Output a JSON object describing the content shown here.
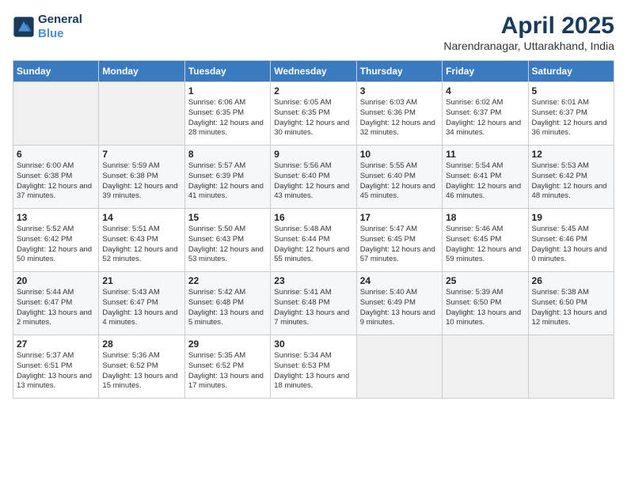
{
  "header": {
    "logo_line1": "General",
    "logo_line2": "Blue",
    "title": "April 2025",
    "subtitle": "Narendranagar, Uttarakhand, India"
  },
  "days_of_week": [
    "Sunday",
    "Monday",
    "Tuesday",
    "Wednesday",
    "Thursday",
    "Friday",
    "Saturday"
  ],
  "weeks": [
    [
      {
        "day": "",
        "info": ""
      },
      {
        "day": "",
        "info": ""
      },
      {
        "day": "1",
        "sunrise": "Sunrise: 6:06 AM",
        "sunset": "Sunset: 6:35 PM",
        "daylight": "Daylight: 12 hours and 28 minutes."
      },
      {
        "day": "2",
        "sunrise": "Sunrise: 6:05 AM",
        "sunset": "Sunset: 6:35 PM",
        "daylight": "Daylight: 12 hours and 30 minutes."
      },
      {
        "day": "3",
        "sunrise": "Sunrise: 6:03 AM",
        "sunset": "Sunset: 6:36 PM",
        "daylight": "Daylight: 12 hours and 32 minutes."
      },
      {
        "day": "4",
        "sunrise": "Sunrise: 6:02 AM",
        "sunset": "Sunset: 6:37 PM",
        "daylight": "Daylight: 12 hours and 34 minutes."
      },
      {
        "day": "5",
        "sunrise": "Sunrise: 6:01 AM",
        "sunset": "Sunset: 6:37 PM",
        "daylight": "Daylight: 12 hours and 36 minutes."
      }
    ],
    [
      {
        "day": "6",
        "sunrise": "Sunrise: 6:00 AM",
        "sunset": "Sunset: 6:38 PM",
        "daylight": "Daylight: 12 hours and 37 minutes."
      },
      {
        "day": "7",
        "sunrise": "Sunrise: 5:59 AM",
        "sunset": "Sunset: 6:38 PM",
        "daylight": "Daylight: 12 hours and 39 minutes."
      },
      {
        "day": "8",
        "sunrise": "Sunrise: 5:57 AM",
        "sunset": "Sunset: 6:39 PM",
        "daylight": "Daylight: 12 hours and 41 minutes."
      },
      {
        "day": "9",
        "sunrise": "Sunrise: 5:56 AM",
        "sunset": "Sunset: 6:40 PM",
        "daylight": "Daylight: 12 hours and 43 minutes."
      },
      {
        "day": "10",
        "sunrise": "Sunrise: 5:55 AM",
        "sunset": "Sunset: 6:40 PM",
        "daylight": "Daylight: 12 hours and 45 minutes."
      },
      {
        "day": "11",
        "sunrise": "Sunrise: 5:54 AM",
        "sunset": "Sunset: 6:41 PM",
        "daylight": "Daylight: 12 hours and 46 minutes."
      },
      {
        "day": "12",
        "sunrise": "Sunrise: 5:53 AM",
        "sunset": "Sunset: 6:42 PM",
        "daylight": "Daylight: 12 hours and 48 minutes."
      }
    ],
    [
      {
        "day": "13",
        "sunrise": "Sunrise: 5:52 AM",
        "sunset": "Sunset: 6:42 PM",
        "daylight": "Daylight: 12 hours and 50 minutes."
      },
      {
        "day": "14",
        "sunrise": "Sunrise: 5:51 AM",
        "sunset": "Sunset: 6:43 PM",
        "daylight": "Daylight: 12 hours and 52 minutes."
      },
      {
        "day": "15",
        "sunrise": "Sunrise: 5:50 AM",
        "sunset": "Sunset: 6:43 PM",
        "daylight": "Daylight: 12 hours and 53 minutes."
      },
      {
        "day": "16",
        "sunrise": "Sunrise: 5:48 AM",
        "sunset": "Sunset: 6:44 PM",
        "daylight": "Daylight: 12 hours and 55 minutes."
      },
      {
        "day": "17",
        "sunrise": "Sunrise: 5:47 AM",
        "sunset": "Sunset: 6:45 PM",
        "daylight": "Daylight: 12 hours and 57 minutes."
      },
      {
        "day": "18",
        "sunrise": "Sunrise: 5:46 AM",
        "sunset": "Sunset: 6:45 PM",
        "daylight": "Daylight: 12 hours and 59 minutes."
      },
      {
        "day": "19",
        "sunrise": "Sunrise: 5:45 AM",
        "sunset": "Sunset: 6:46 PM",
        "daylight": "Daylight: 13 hours and 0 minutes."
      }
    ],
    [
      {
        "day": "20",
        "sunrise": "Sunrise: 5:44 AM",
        "sunset": "Sunset: 6:47 PM",
        "daylight": "Daylight: 13 hours and 2 minutes."
      },
      {
        "day": "21",
        "sunrise": "Sunrise: 5:43 AM",
        "sunset": "Sunset: 6:47 PM",
        "daylight": "Daylight: 13 hours and 4 minutes."
      },
      {
        "day": "22",
        "sunrise": "Sunrise: 5:42 AM",
        "sunset": "Sunset: 6:48 PM",
        "daylight": "Daylight: 13 hours and 5 minutes."
      },
      {
        "day": "23",
        "sunrise": "Sunrise: 5:41 AM",
        "sunset": "Sunset: 6:48 PM",
        "daylight": "Daylight: 13 hours and 7 minutes."
      },
      {
        "day": "24",
        "sunrise": "Sunrise: 5:40 AM",
        "sunset": "Sunset: 6:49 PM",
        "daylight": "Daylight: 13 hours and 9 minutes."
      },
      {
        "day": "25",
        "sunrise": "Sunrise: 5:39 AM",
        "sunset": "Sunset: 6:50 PM",
        "daylight": "Daylight: 13 hours and 10 minutes."
      },
      {
        "day": "26",
        "sunrise": "Sunrise: 5:38 AM",
        "sunset": "Sunset: 6:50 PM",
        "daylight": "Daylight: 13 hours and 12 minutes."
      }
    ],
    [
      {
        "day": "27",
        "sunrise": "Sunrise: 5:37 AM",
        "sunset": "Sunset: 6:51 PM",
        "daylight": "Daylight: 13 hours and 13 minutes."
      },
      {
        "day": "28",
        "sunrise": "Sunrise: 5:36 AM",
        "sunset": "Sunset: 6:52 PM",
        "daylight": "Daylight: 13 hours and 15 minutes."
      },
      {
        "day": "29",
        "sunrise": "Sunrise: 5:35 AM",
        "sunset": "Sunset: 6:52 PM",
        "daylight": "Daylight: 13 hours and 17 minutes."
      },
      {
        "day": "30",
        "sunrise": "Sunrise: 5:34 AM",
        "sunset": "Sunset: 6:53 PM",
        "daylight": "Daylight: 13 hours and 18 minutes."
      },
      {
        "day": "",
        "info": ""
      },
      {
        "day": "",
        "info": ""
      },
      {
        "day": "",
        "info": ""
      }
    ]
  ]
}
